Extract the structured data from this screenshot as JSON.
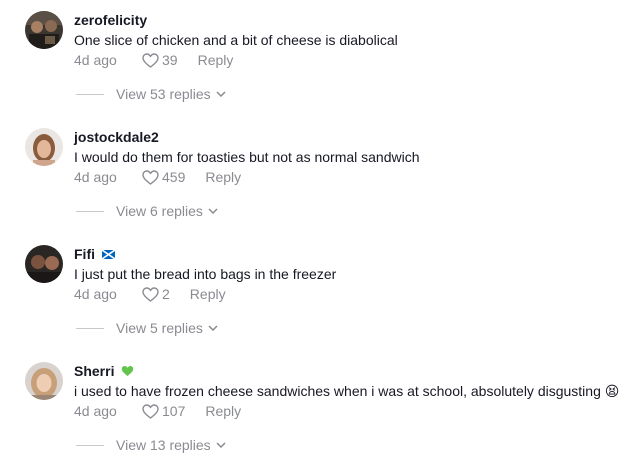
{
  "comments": [
    {
      "username": "zerofelicity",
      "badge": "",
      "text": "One slice of chicken and a bit of cheese is diabolical",
      "time": "4d ago",
      "likes": "39",
      "reply_label": "Reply",
      "view_replies": "View 53 replies"
    },
    {
      "username": "jostockdale2",
      "badge": "",
      "text": "I would do them for toasties but not as normal sandwich",
      "time": "4d ago",
      "likes": "459",
      "reply_label": "Reply",
      "view_replies": "View 6 replies"
    },
    {
      "username": "Fifi",
      "badge": "scotland-flag-icon",
      "text": "I just put the bread into bags in the freezer",
      "time": "4d ago",
      "likes": "2",
      "reply_label": "Reply",
      "view_replies": "View 5 replies"
    },
    {
      "username": "Sherri",
      "badge": "green-heart-icon",
      "text": "i used to have frozen cheese sandwiches when i was at school, absolutely disgusting",
      "emoji": "😫",
      "time": "4d ago",
      "likes": "107",
      "reply_label": "Reply",
      "view_replies": "View 13 replies"
    }
  ],
  "colors": {
    "text": "#161823",
    "muted": "#8a8b91",
    "divider": "#c9c9cc",
    "green_heart": "#62c44d",
    "flag_blue": "#0065bd"
  }
}
